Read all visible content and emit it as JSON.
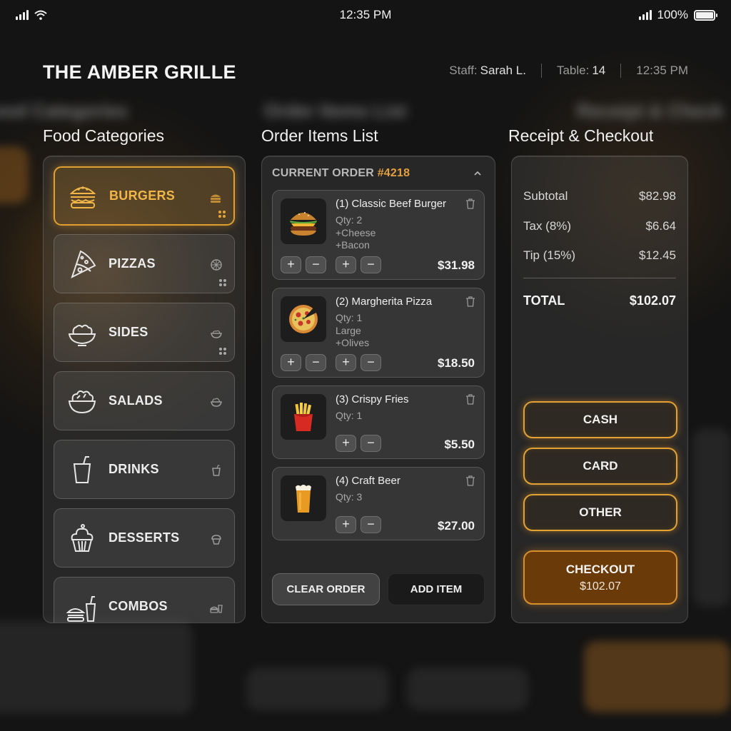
{
  "status_bar": {
    "time": "12:35 PM",
    "battery": "100%"
  },
  "header": {
    "title": "THE AMBER GRILLE",
    "staff_label": "Staff:",
    "staff_value": "Sarah L.",
    "table_label": "Table:",
    "table_value": "14",
    "time": "12:35 PM"
  },
  "sections": {
    "categories": "Food Categories",
    "order": "Order Items List",
    "receipt": "Receipt & Checkout"
  },
  "categories": [
    {
      "label": "BURGERS",
      "icon": "burger-icon",
      "active": true
    },
    {
      "label": "PIZZAS",
      "icon": "pizza-icon",
      "active": false
    },
    {
      "label": "SIDES",
      "icon": "sides-bowl-icon",
      "active": false
    },
    {
      "label": "SALADS",
      "icon": "salad-icon",
      "active": false
    },
    {
      "label": "DRINKS",
      "icon": "drink-cup-icon",
      "active": false
    },
    {
      "label": "DESSERTS",
      "icon": "cupcake-icon",
      "active": false
    },
    {
      "label": "COMBOS",
      "icon": "combo-icon",
      "active": false
    }
  ],
  "order": {
    "title": "CURRENT ORDER",
    "number": "#4218",
    "items": [
      {
        "name": "(1) Classic Beef Burger",
        "qty": "Qty: 2",
        "mods": [
          "+Cheese",
          "+Bacon"
        ],
        "price": "$31.98",
        "icon": "burger-photo-icon"
      },
      {
        "name": "(2) Margherita Pizza",
        "qty": "Qty: 1",
        "mods": [
          "Large",
          "+Olives"
        ],
        "price": "$18.50",
        "icon": "pizza-photo-icon"
      },
      {
        "name": "(3) Crispy Fries",
        "qty": "Qty: 1",
        "mods": [],
        "price": "$5.50",
        "icon": "fries-photo-icon"
      },
      {
        "name": "(4) Craft Beer",
        "qty": "Qty: 3",
        "mods": [],
        "price": "$27.00",
        "icon": "beer-photo-icon"
      }
    ],
    "plus": "+",
    "minus": "−",
    "clear_label": "CLEAR ORDER",
    "add_label": "ADD ITEM"
  },
  "receipt": {
    "subtotal_label": "Subtotal",
    "subtotal": "$82.98",
    "tax_label": "Tax (8%)",
    "tax": "$6.64",
    "tip_label": "Tip (15%)",
    "tip": "$12.45",
    "total_label": "TOTAL",
    "total": "$102.07",
    "cash_label": "CASH",
    "card_label": "CARD",
    "other_label": "OTHER",
    "checkout_label": "CHECKOUT",
    "checkout_amount": "$102.07"
  },
  "colors": {
    "accent": "#e3a233",
    "checkout_bg": "#6a3b08",
    "order_number": "#e3a03d"
  }
}
